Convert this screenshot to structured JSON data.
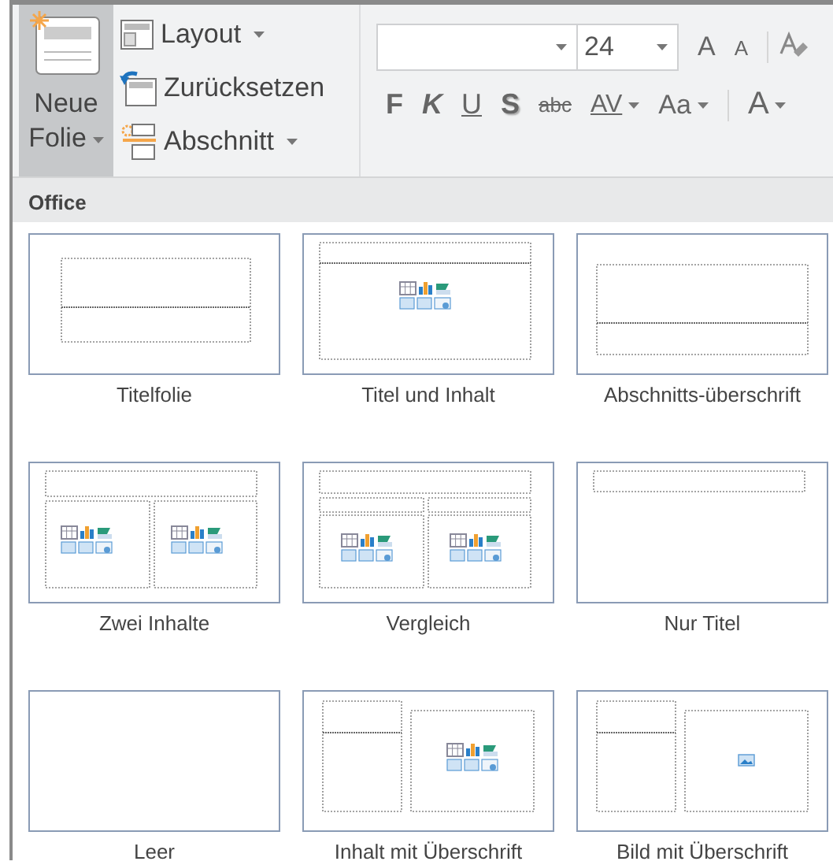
{
  "ribbon": {
    "new_slide": {
      "label": "Neue Folie",
      "dropdown": true
    },
    "slide_commands": [
      {
        "label": "Layout",
        "kind": "layout",
        "dropdown": true
      },
      {
        "label": "Zurücksetzen",
        "kind": "reset",
        "dropdown": false
      },
      {
        "label": "Abschnitt",
        "kind": "section",
        "dropdown": true
      }
    ],
    "font": {
      "font_size": "24",
      "size_buttons": [
        {
          "label": "A",
          "kind": "grow"
        },
        {
          "label": "A",
          "kind": "shrink"
        }
      ],
      "format_buttons": [
        {
          "label": "F",
          "kind": "bold",
          "dropdown": false
        },
        {
          "label": "K",
          "kind": "italic",
          "dropdown": false
        },
        {
          "label": "U",
          "kind": "underline",
          "dropdown": false
        },
        {
          "label": "S",
          "kind": "shadow",
          "dropdown": false
        },
        {
          "label": "abc",
          "kind": "strike",
          "dropdown": false
        },
        {
          "label": "AV",
          "kind": "spacing",
          "dropdown": true
        },
        {
          "label": "Aa",
          "kind": "case",
          "dropdown": true
        },
        {
          "label": "A",
          "kind": "color",
          "dropdown": true
        }
      ]
    }
  },
  "gallery": {
    "heading": "Office",
    "layouts": [
      {
        "label": "Titelfolie",
        "kind": "title"
      },
      {
        "label": "Titel und Inhalt",
        "kind": "title-content"
      },
      {
        "label": "Abschnitts-überschrift",
        "kind": "section"
      },
      {
        "label": "Zwei Inhalte",
        "kind": "two-content"
      },
      {
        "label": "Vergleich",
        "kind": "comparison"
      },
      {
        "label": "Nur Titel",
        "kind": "title-only"
      },
      {
        "label": "Leer",
        "kind": "blank"
      },
      {
        "label": "Inhalt mit Überschrift",
        "kind": "content-caption"
      },
      {
        "label": "Bild mit Überschrift",
        "kind": "picture-caption"
      }
    ]
  }
}
